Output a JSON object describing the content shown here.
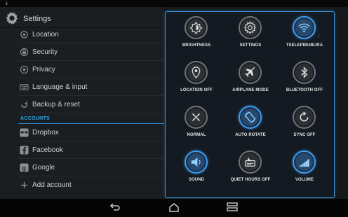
{
  "status_bar": {
    "download_glyph": "⇣"
  },
  "settings": {
    "title": "Settings",
    "items": [
      {
        "label": "Location",
        "icon": "location-icon"
      },
      {
        "label": "Security",
        "icon": "lock-icon"
      },
      {
        "label": "Privacy",
        "icon": "privacy-icon"
      },
      {
        "label": "Language & input",
        "icon": "keyboard-icon"
      },
      {
        "label": "Backup & reset",
        "icon": "backup-icon"
      }
    ],
    "accounts_header": "ACCOUNTS",
    "accounts": [
      {
        "label": "Dropbox",
        "icon": "dropbox-icon"
      },
      {
        "label": "Facebook",
        "icon": "facebook-icon"
      },
      {
        "label": "Google",
        "icon": "google-icon"
      },
      {
        "label": "Add account",
        "icon": "plus-icon"
      }
    ]
  },
  "quick_panel": {
    "tiles": [
      {
        "label": "BRIGHTNESS",
        "icon": "brightness-icon",
        "on": false
      },
      {
        "label": "SETTINGS",
        "icon": "gear-icon",
        "on": false
      },
      {
        "label": "TSELEPIBUBURA",
        "icon": "wifi-icon",
        "on": true
      },
      {
        "label": "LOCATION OFF",
        "icon": "location-pin-icon",
        "on": false
      },
      {
        "label": "AIRPLANE MODE",
        "icon": "airplane-icon",
        "on": false
      },
      {
        "label": "BLUETOOTH OFF",
        "icon": "bluetooth-icon",
        "on": false
      },
      {
        "label": "NORMAL",
        "icon": "normal-mode-icon",
        "on": false
      },
      {
        "label": "AUTO ROTATE",
        "icon": "rotate-icon",
        "on": true
      },
      {
        "label": "SYNC OFF",
        "icon": "sync-icon",
        "on": false
      },
      {
        "label": "SOUND",
        "icon": "speaker-icon",
        "on": true
      },
      {
        "label": "QUIET HOURS OFF",
        "icon": "quiet-hours-icon",
        "on": false
      },
      {
        "label": "VOLUME",
        "icon": "volume-bars-icon",
        "on": true
      }
    ]
  },
  "navbar": {
    "buttons": [
      "back-icon",
      "home-icon",
      "recents-icon"
    ]
  },
  "colors": {
    "accent": "#3d9df0",
    "section": "#33a6e6"
  }
}
